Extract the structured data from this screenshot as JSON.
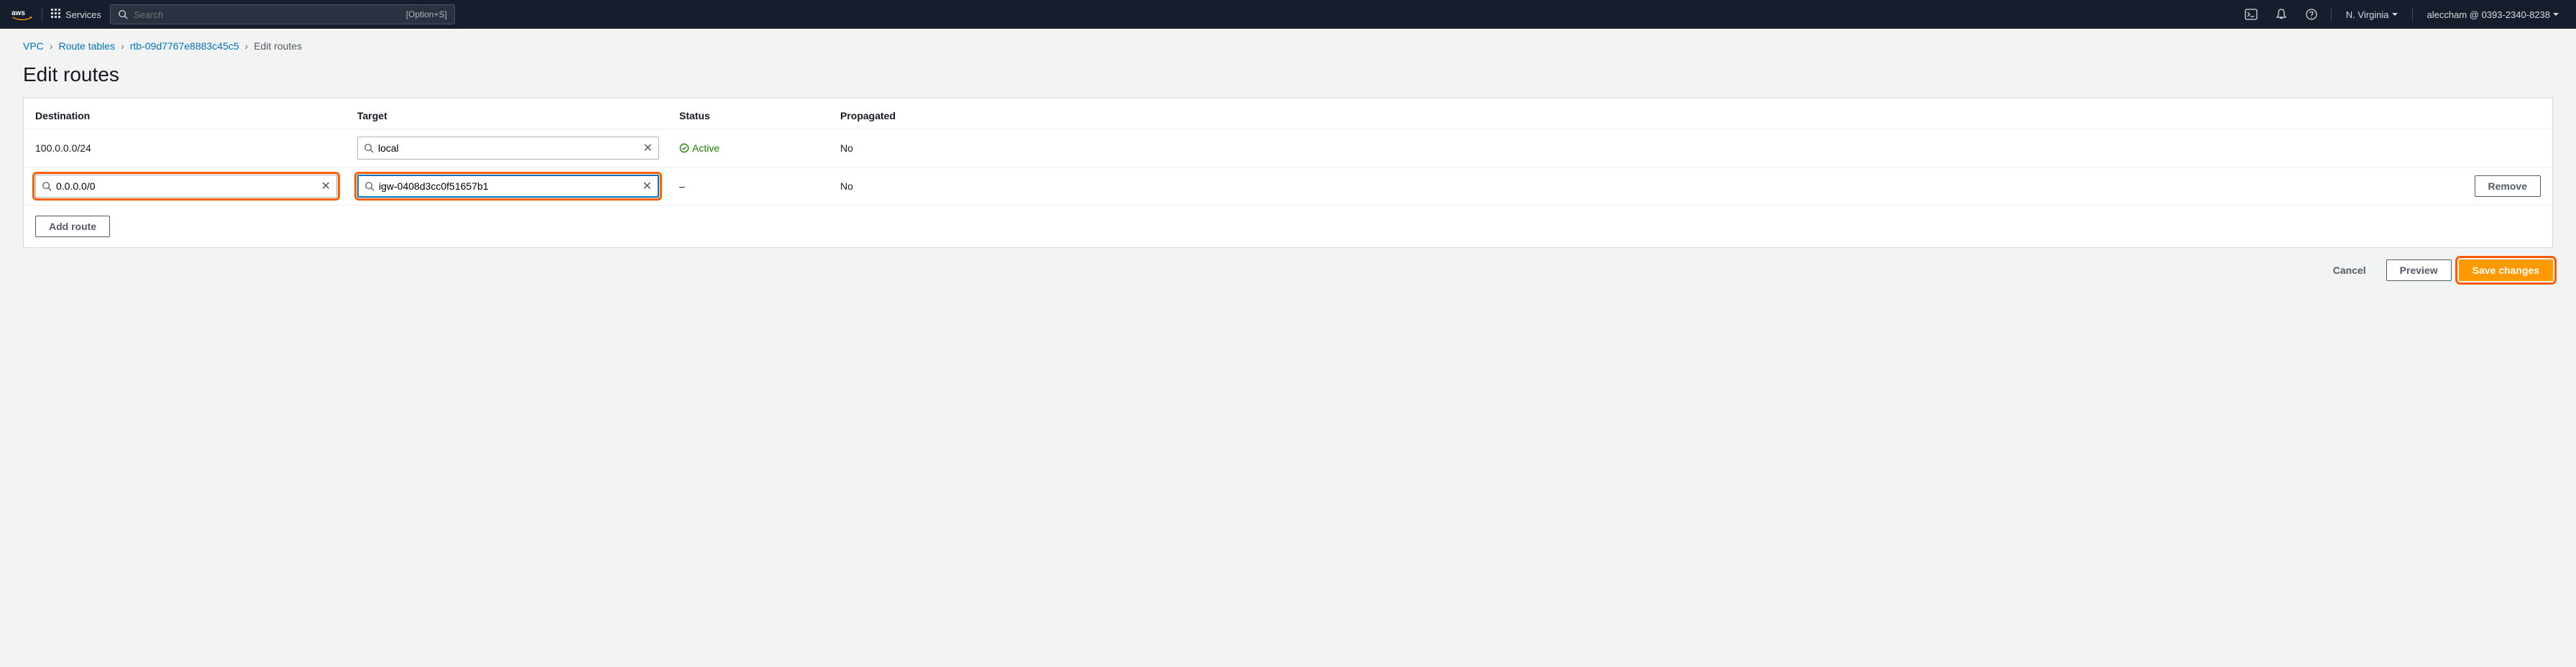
{
  "nav": {
    "services_label": "Services",
    "search_placeholder": "Search",
    "search_shortcut": "[Option+S]",
    "region": "N. Virginia",
    "account": "aleccham @ 0393-2340-8238"
  },
  "breadcrumb": {
    "vpc": "VPC",
    "route_tables": "Route tables",
    "rtb_id": "rtb-09d7767e8883c45c5",
    "current": "Edit routes"
  },
  "page": {
    "title": "Edit routes"
  },
  "table": {
    "headers": {
      "destination": "Destination",
      "target": "Target",
      "status": "Status",
      "propagated": "Propagated"
    },
    "rows": [
      {
        "destination": "100.0.0.0/24",
        "target": "local",
        "status": "Active",
        "propagated": "No",
        "removable": false
      },
      {
        "destination": "0.0.0.0/0",
        "target": "igw-0408d3cc0f51657b1",
        "status": "–",
        "propagated": "No",
        "removable": true
      }
    ]
  },
  "buttons": {
    "add_route": "Add route",
    "remove": "Remove",
    "cancel": "Cancel",
    "preview": "Preview",
    "save": "Save changes"
  }
}
